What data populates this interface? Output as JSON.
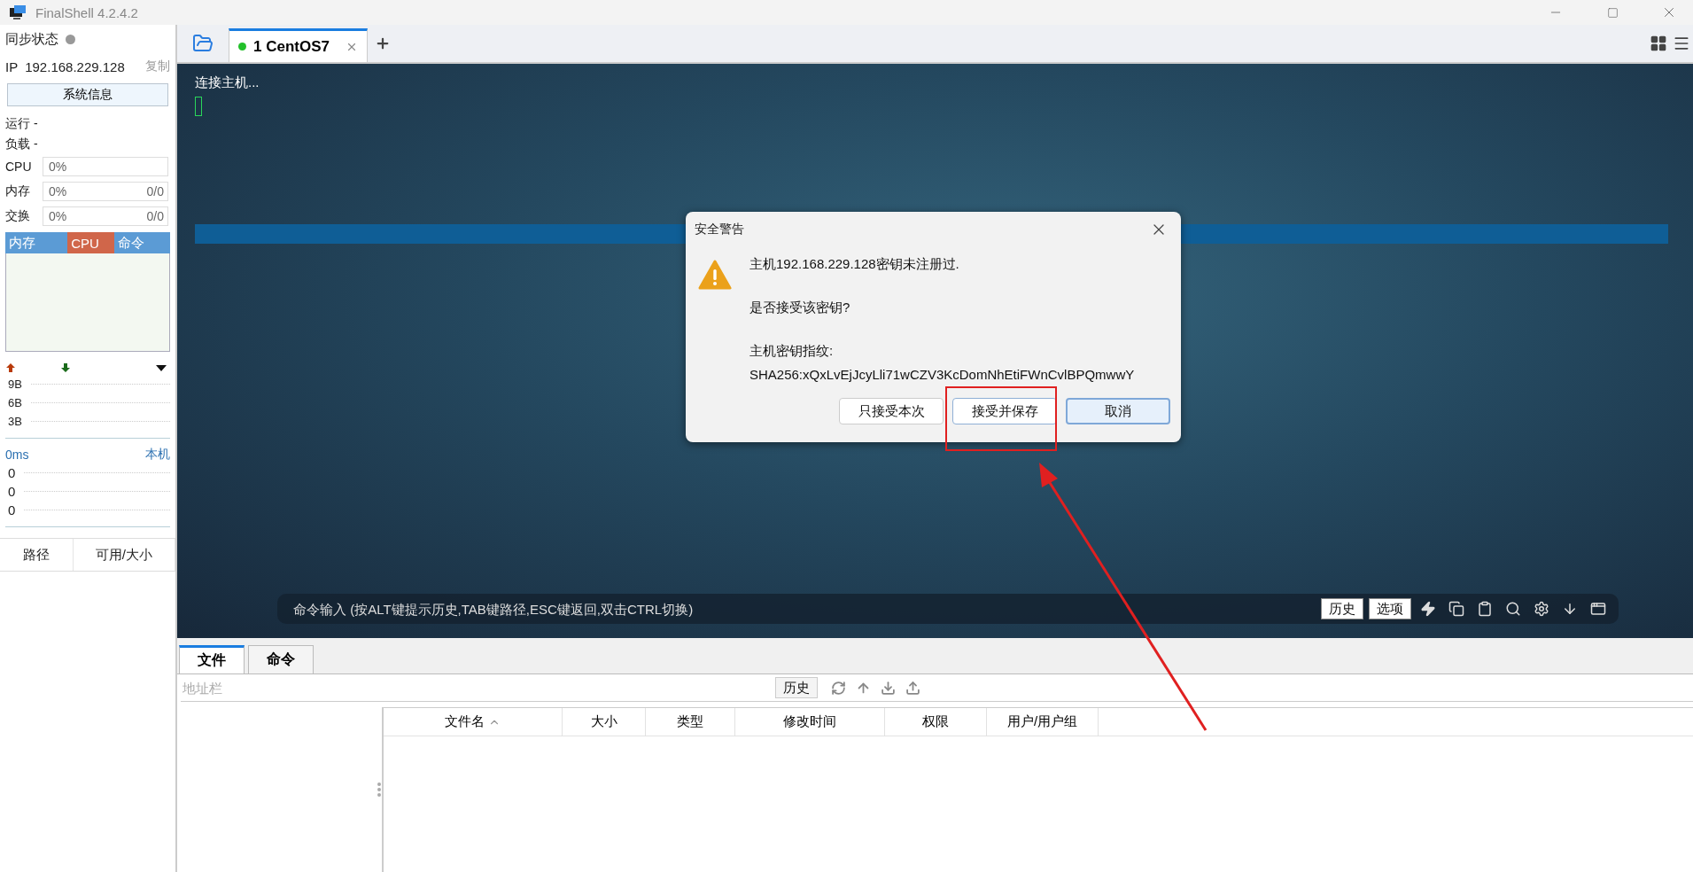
{
  "window": {
    "title": "FinalShell 4.2.4.2"
  },
  "sidebar": {
    "sync_label": "同步状态",
    "ip": {
      "label": "IP",
      "value": "192.168.229.128",
      "copy": "复制"
    },
    "sysinfo_button": "系统信息",
    "info_lines": [
      "运行 -",
      "负载 -"
    ],
    "meters": [
      {
        "label": "CPU",
        "reading": "0%",
        "level": 0
      },
      {
        "label": "内存",
        "reading": "0%",
        "amount": "0/0",
        "level": 0
      },
      {
        "label": "交换",
        "reading": "0%",
        "amount": "0/0",
        "level": 0
      }
    ],
    "monitor_tabs": [
      {
        "label": "内存",
        "selected": false
      },
      {
        "label": "CPU",
        "selected": true
      },
      {
        "label": "命令",
        "selected": false
      }
    ],
    "net_scale": [
      "9B",
      "6B",
      "3B"
    ],
    "ping": {
      "latency": "0ms",
      "host": "本机",
      "values": [
        "0",
        "0",
        "0"
      ]
    },
    "disk_columns": [
      "路径",
      "可用/大小"
    ]
  },
  "tabs": [
    {
      "label": "1 CentOS7",
      "selected": true,
      "connected": true
    }
  ],
  "terminal": {
    "lines": [
      "连接主机..."
    ]
  },
  "dialog": {
    "title": "安全警告",
    "lines": [
      "主机192.168.229.128密钥未注册过.",
      "是否接受该密钥?",
      "主机密钥指纹:",
      "SHA256:xQxLvEjJcyLli71wCZV3KcDomNhEtiFWnCvlBPQmwwY"
    ],
    "buttons": [
      {
        "label": "只接受本次",
        "default": false,
        "focused": false
      },
      {
        "label": "接受并保存",
        "default": false,
        "focused": true
      },
      {
        "label": "取消",
        "default": true,
        "focused": false
      }
    ]
  },
  "command_bar": {
    "placeholder": "命令输入 (按ALT键提示历史,TAB键路径,ESC键返回,双击CTRL切换)",
    "buttons": [
      "历史",
      "选项"
    ]
  },
  "bottom_tabs": [
    {
      "label": "文件",
      "selected": true
    },
    {
      "label": "命令",
      "selected": false
    }
  ],
  "file_browser": {
    "address_placeholder": "地址栏",
    "history_button": "历史",
    "columns": [
      {
        "label": "文件名",
        "sorted": true
      },
      {
        "label": "大小",
        "sorted": false
      },
      {
        "label": "类型",
        "sorted": false
      },
      {
        "label": "修改时间",
        "sorted": false
      },
      {
        "label": "权限",
        "sorted": false
      },
      {
        "label": "用户/用户组",
        "sorted": false
      }
    ]
  }
}
